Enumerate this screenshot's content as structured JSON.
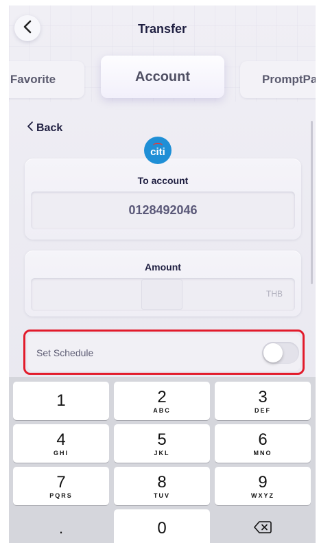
{
  "header": {
    "title": "Transfer",
    "back_icon": "chevron-left-icon"
  },
  "tabs": [
    {
      "label": "Favorite",
      "active": false
    },
    {
      "label": "Account",
      "active": true
    },
    {
      "label": "PromptPa",
      "active": false
    }
  ],
  "back_link": {
    "label": "Back"
  },
  "bank": {
    "logo_text": "citi",
    "color": "#1f8fd6"
  },
  "to_account": {
    "label": "To account",
    "value": "0128492046"
  },
  "amount": {
    "label": "Amount",
    "value": "",
    "currency": "THB"
  },
  "schedule": {
    "label": "Set Schedule",
    "enabled": false,
    "highlight_color": "#e21b2b"
  },
  "keypad": {
    "keys": [
      {
        "num": "1",
        "letters": ""
      },
      {
        "num": "2",
        "letters": "ABC"
      },
      {
        "num": "3",
        "letters": "DEF"
      },
      {
        "num": "4",
        "letters": "GHI"
      },
      {
        "num": "5",
        "letters": "JKL"
      },
      {
        "num": "6",
        "letters": "MNO"
      },
      {
        "num": "7",
        "letters": "PQRS"
      },
      {
        "num": "8",
        "letters": "TUV"
      },
      {
        "num": "9",
        "letters": "WXYZ"
      },
      {
        "num": ".",
        "letters": ""
      },
      {
        "num": "0",
        "letters": ""
      },
      {
        "num": "",
        "letters": "",
        "icon": "backspace-icon"
      }
    ]
  }
}
